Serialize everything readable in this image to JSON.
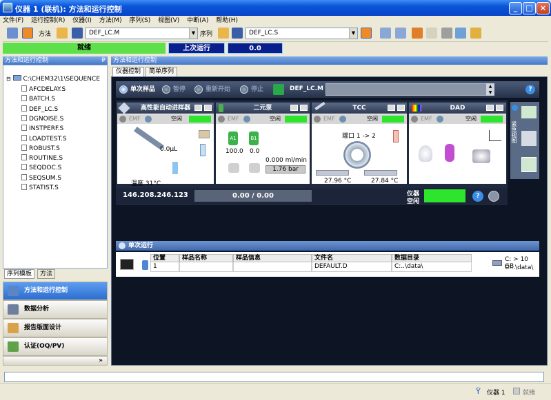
{
  "window": {
    "title": "仪器 1 (联机): 方法和运行控制"
  },
  "menu": [
    "文件(F)",
    "运行控制(R)",
    "仪器(I)",
    "方法(M)",
    "序列(S)",
    "视图(V)",
    "中断(A)",
    "帮助(H)"
  ],
  "toolbar": {
    "method_label": "方法",
    "method_value": "DEF_LC.M",
    "sequence_label": "序列",
    "sequence_value": "DEF_LC.S"
  },
  "status": {
    "state": "就绪",
    "last_run_label": "上次运行",
    "last_run_value": "0.0"
  },
  "left_panel": {
    "header": "方法和运行控制",
    "root": "C:\\CHEM32\\1\\SEQUENCE",
    "files": [
      "AFCDELAY.S",
      "BATCH.S",
      "DEF_LC.S",
      "DGNOISE.S",
      "INSTPERF.S",
      "LOADTEST.S",
      "ROBUST.S",
      "ROUTINE.S",
      "SEQDOC.S",
      "SEQSUM.S",
      "STATIST.S"
    ],
    "tabs": [
      "序列模板",
      "方法"
    ],
    "nav": [
      "方法和运行控制",
      "数据分析",
      "报告版面设计",
      "认证(OQ/PV)"
    ],
    "more": "»"
  },
  "right_panel": {
    "header": "方法和运行控制",
    "tabs": [
      "仪器控制",
      "简单序列"
    ],
    "controls": {
      "single_sample": "单次样品",
      "pause": "暂停",
      "restart": "重新开始",
      "stop": "停止",
      "method": "DEF_LC.M",
      "help": "?"
    },
    "devices": [
      {
        "name": "高性能自动进样器",
        "emf": "EMF",
        "state": "空闲",
        "volume": "0.0µL",
        "temperature": "温度 31°C"
      },
      {
        "name": "二元泵",
        "emf": "EMF",
        "state": "空闲",
        "a1_label": "A1",
        "b1_label": "B1",
        "a1_value": "100.0",
        "b1_value": "0.0",
        "flow": "0.000 ml/min",
        "pressure": "1.76 bar"
      },
      {
        "name": "TCC",
        "emf": "EMF",
        "state": "空闲",
        "port": "端口 1 -> 2",
        "temp_left": "27.96 °C",
        "temp_right": "27.84 °C"
      },
      {
        "name": "DAD",
        "emf": "EMF",
        "state": "空闲"
      }
    ],
    "side_label": "紧急视图",
    "ip_address": "146.208.246.123",
    "run_progress": "0.00 / 0.00",
    "instrument_label": "仪器",
    "instrument_state": "空闲",
    "single_run": {
      "header": "单次运行",
      "columns": [
        "位置",
        "样品名称",
        "样品信息",
        "文件名",
        "数据目录"
      ],
      "row": [
        "1",
        "",
        "",
        "DEFAULT.D",
        "C:..\\data\\"
      ],
      "disk": "C: > 10 GB",
      "disk_path": "C:..\\data\\"
    }
  },
  "statusbar": {
    "instrument": "仪器 1",
    "state": "就绪"
  }
}
